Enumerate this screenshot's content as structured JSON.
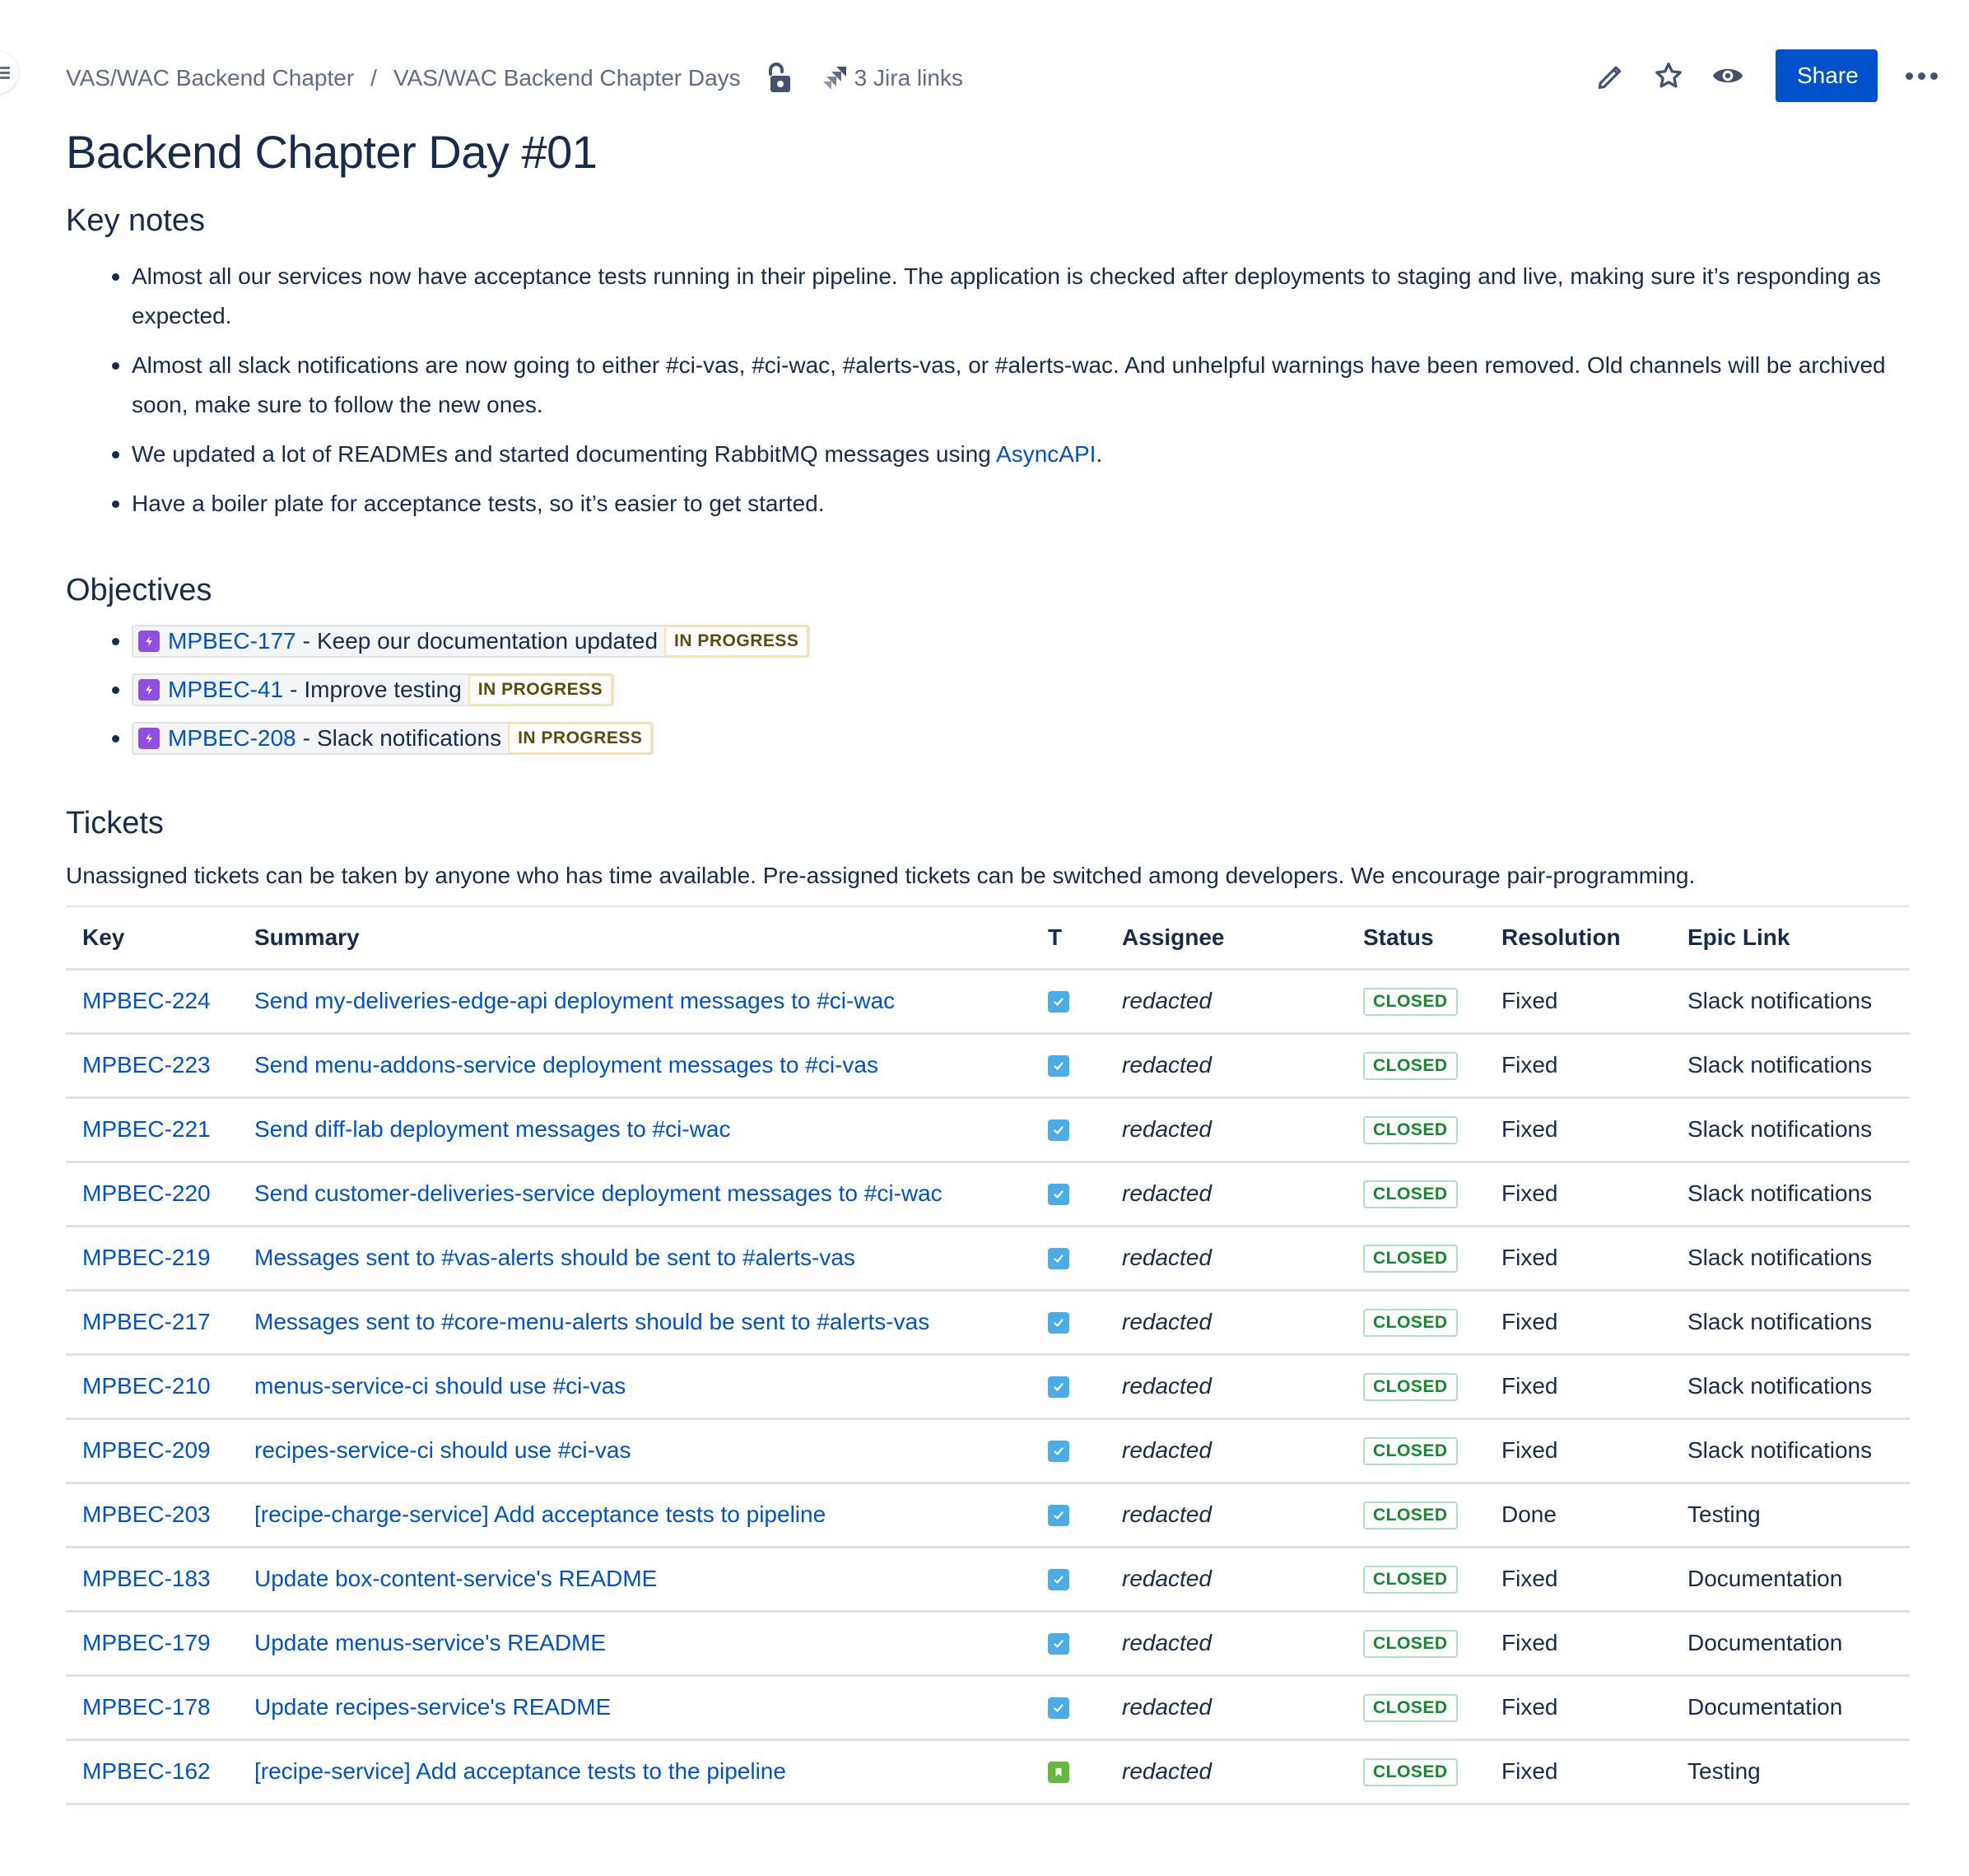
{
  "breadcrumb": {
    "items": [
      "VAS/WAC Backend Chapter",
      "VAS/WAC Backend Chapter Days"
    ],
    "separator": "/"
  },
  "header": {
    "jira_links_label": "3 Jira links",
    "share_label": "Share",
    "icons": [
      "unlock-icon",
      "jira-icon",
      "edit-icon",
      "star-icon",
      "watch-icon",
      "more-icon"
    ]
  },
  "page": {
    "title": "Backend Chapter Day #01"
  },
  "key_notes": {
    "heading": "Key notes",
    "items": [
      {
        "text": "Almost all our services now have acceptance tests running in their pipeline. The application is checked after deployments to staging and live, making sure it’s responding as expected."
      },
      {
        "text": "Almost all slack notifications are now going to either #ci-vas, #ci-wac, #alerts-vas, or #alerts-wac. And unhelpful warnings have been removed. Old channels will be archived soon, make sure to follow the new ones."
      },
      {
        "text_before": "We updated a lot of READMEs and started documenting RabbitMQ messages using ",
        "link": "AsyncAPI",
        "text_after": "."
      },
      {
        "text": "Have a boiler plate for acceptance tests, so it’s easier to get started."
      }
    ]
  },
  "objectives": {
    "heading": "Objectives",
    "items": [
      {
        "key": "MPBEC-177",
        "summary": "Keep our documentation updated",
        "status": "IN PROGRESS"
      },
      {
        "key": "MPBEC-41",
        "summary": "Improve testing",
        "status": "IN PROGRESS"
      },
      {
        "key": "MPBEC-208",
        "summary": "Slack notifications",
        "status": "IN PROGRESS"
      }
    ],
    "dash": "-"
  },
  "tickets": {
    "heading": "Tickets",
    "intro": "Unassigned tickets can be taken by anyone who has time available. Pre-assigned tickets can be switched among developers. We encourage pair-programming.",
    "columns": [
      "Key",
      "Summary",
      "T",
      "Assignee",
      "Status",
      "Resolution",
      "Epic Link"
    ],
    "rows": [
      {
        "key": "MPBEC-224",
        "summary": "Send my-deliveries-edge-api deployment messages to #ci-wac",
        "type": "task",
        "assignee": "redacted",
        "status": "CLOSED",
        "resolution": "Fixed",
        "epic": "Slack notifications"
      },
      {
        "key": "MPBEC-223",
        "summary": "Send menu-addons-service deployment messages to #ci-vas",
        "type": "task",
        "assignee": "redacted",
        "status": "CLOSED",
        "resolution": "Fixed",
        "epic": "Slack notifications"
      },
      {
        "key": "MPBEC-221",
        "summary": "Send diff-lab deployment messages to #ci-wac",
        "type": "task",
        "assignee": "redacted",
        "status": "CLOSED",
        "resolution": "Fixed",
        "epic": "Slack notifications"
      },
      {
        "key": "MPBEC-220",
        "summary": "Send customer-deliveries-service deployment messages to #ci-wac",
        "type": "task",
        "assignee": "redacted",
        "status": "CLOSED",
        "resolution": "Fixed",
        "epic": "Slack notifications"
      },
      {
        "key": "MPBEC-219",
        "summary": "Messages sent to #vas-alerts should be sent to #alerts-vas",
        "type": "task",
        "assignee": "redacted",
        "status": "CLOSED",
        "resolution": "Fixed",
        "epic": "Slack notifications"
      },
      {
        "key": "MPBEC-217",
        "summary": "Messages sent to #core-menu-alerts should be sent to #alerts-vas",
        "type": "task",
        "assignee": "redacted",
        "status": "CLOSED",
        "resolution": "Fixed",
        "epic": "Slack notifications"
      },
      {
        "key": "MPBEC-210",
        "summary": "menus-service-ci should use #ci-vas",
        "type": "task",
        "assignee": "redacted",
        "status": "CLOSED",
        "resolution": "Fixed",
        "epic": "Slack notifications"
      },
      {
        "key": "MPBEC-209",
        "summary": "recipes-service-ci should use #ci-vas",
        "type": "task",
        "assignee": "redacted",
        "status": "CLOSED",
        "resolution": "Fixed",
        "epic": "Slack notifications"
      },
      {
        "key": "MPBEC-203",
        "summary": "[recipe-charge-service] Add acceptance tests to pipeline",
        "type": "task",
        "assignee": "redacted",
        "status": "CLOSED",
        "resolution": "Done",
        "epic": "Testing"
      },
      {
        "key": "MPBEC-183",
        "summary": "Update box-content-service's README",
        "type": "task",
        "assignee": "redacted",
        "status": "CLOSED",
        "resolution": "Fixed",
        "epic": "Documentation"
      },
      {
        "key": "MPBEC-179",
        "summary": "Update menus-service's README",
        "type": "task",
        "assignee": "redacted",
        "status": "CLOSED",
        "resolution": "Fixed",
        "epic": "Documentation"
      },
      {
        "key": "MPBEC-178",
        "summary": "Update recipes-service's README",
        "type": "task",
        "assignee": "redacted",
        "status": "CLOSED",
        "resolution": "Fixed",
        "epic": "Documentation"
      },
      {
        "key": "MPBEC-162",
        "summary": "[recipe-service] Add acceptance tests to the pipeline",
        "type": "story",
        "assignee": "redacted",
        "status": "CLOSED",
        "resolution": "Fixed",
        "epic": "Testing"
      }
    ]
  },
  "colors": {
    "primary": "#0052cc",
    "text": "#172b4d",
    "subtle": "#5e6c84",
    "epic": "#904ee2",
    "task": "#4bade8",
    "story": "#63ba3c",
    "closed": "#14892c",
    "in_progress": "#5e4a0a"
  }
}
